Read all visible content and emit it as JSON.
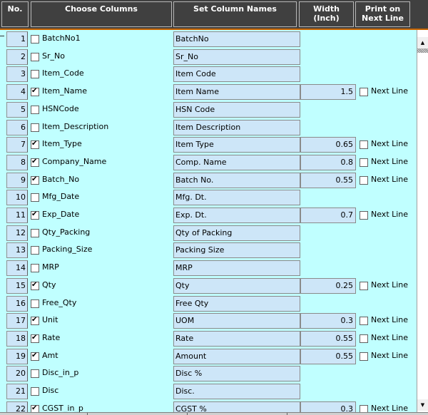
{
  "header": {
    "no": "No.",
    "choose_columns": "Choose Columns",
    "set_column_names": "Set Column Names",
    "width_line1": "Width",
    "width_line2": "(Inch)",
    "print_line1": "Print on",
    "print_line2": "Next Line"
  },
  "next_line_label": "Next Line",
  "rows": [
    {
      "no": "1",
      "column": "BatchNo1",
      "checked": false,
      "name": "BatchNo",
      "width": null,
      "next_line": null
    },
    {
      "no": "2",
      "column": "Sr_No",
      "checked": false,
      "name": "Sr_No",
      "width": null,
      "next_line": null
    },
    {
      "no": "3",
      "column": "Item_Code",
      "checked": false,
      "name": "Item Code",
      "width": null,
      "next_line": null
    },
    {
      "no": "4",
      "column": "Item_Name",
      "checked": true,
      "name": "Item Name",
      "width": "1.5",
      "next_line": false
    },
    {
      "no": "5",
      "column": "HSNCode",
      "checked": false,
      "name": "HSN Code",
      "width": null,
      "next_line": null
    },
    {
      "no": "6",
      "column": "Item_Description",
      "checked": false,
      "name": "Item Description",
      "width": null,
      "next_line": null
    },
    {
      "no": "7",
      "column": "Item_Type",
      "checked": true,
      "name": "Item Type",
      "width": "0.65",
      "next_line": false
    },
    {
      "no": "8",
      "column": "Company_Name",
      "checked": true,
      "name": "Comp. Name",
      "width": "0.8",
      "next_line": false
    },
    {
      "no": "9",
      "column": "Batch_No",
      "checked": true,
      "name": "Batch No.",
      "width": "0.55",
      "next_line": false
    },
    {
      "no": "10",
      "column": "Mfg_Date",
      "checked": false,
      "name": "Mfg. Dt.",
      "width": null,
      "next_line": null
    },
    {
      "no": "11",
      "column": "Exp_Date",
      "checked": true,
      "name": "Exp. Dt.",
      "width": "0.7",
      "next_line": false
    },
    {
      "no": "12",
      "column": "Qty_Packing",
      "checked": false,
      "name": "Qty of Packing",
      "width": null,
      "next_line": null
    },
    {
      "no": "13",
      "column": "Packing_Size",
      "checked": false,
      "name": "Packing Size",
      "width": null,
      "next_line": null
    },
    {
      "no": "14",
      "column": "MRP",
      "checked": false,
      "name": "MRP",
      "width": null,
      "next_line": null
    },
    {
      "no": "15",
      "column": "Qty",
      "checked": true,
      "name": "Qty",
      "width": "0.25",
      "next_line": false
    },
    {
      "no": "16",
      "column": "Free_Qty",
      "checked": false,
      "name": "Free Qty",
      "width": null,
      "next_line": null
    },
    {
      "no": "17",
      "column": "Unit",
      "checked": true,
      "name": "UOM",
      "width": "0.3",
      "next_line": false
    },
    {
      "no": "18",
      "column": "Rate",
      "checked": true,
      "name": "Rate",
      "width": "0.55",
      "next_line": false
    },
    {
      "no": "19",
      "column": "Amt",
      "checked": true,
      "name": "Amount",
      "width": "0.55",
      "next_line": false
    },
    {
      "no": "20",
      "column": "Disc_in_p",
      "checked": false,
      "name": "Disc %",
      "width": null,
      "next_line": null
    },
    {
      "no": "21",
      "column": "Disc",
      "checked": false,
      "name": "Disc.",
      "width": null,
      "next_line": null
    },
    {
      "no": "22",
      "column": "CGST_in_p",
      "checked": true,
      "name": "CGST %",
      "width": "0.3",
      "next_line": false
    }
  ],
  "scrollbar": {
    "up": "▲",
    "down": "▼"
  }
}
